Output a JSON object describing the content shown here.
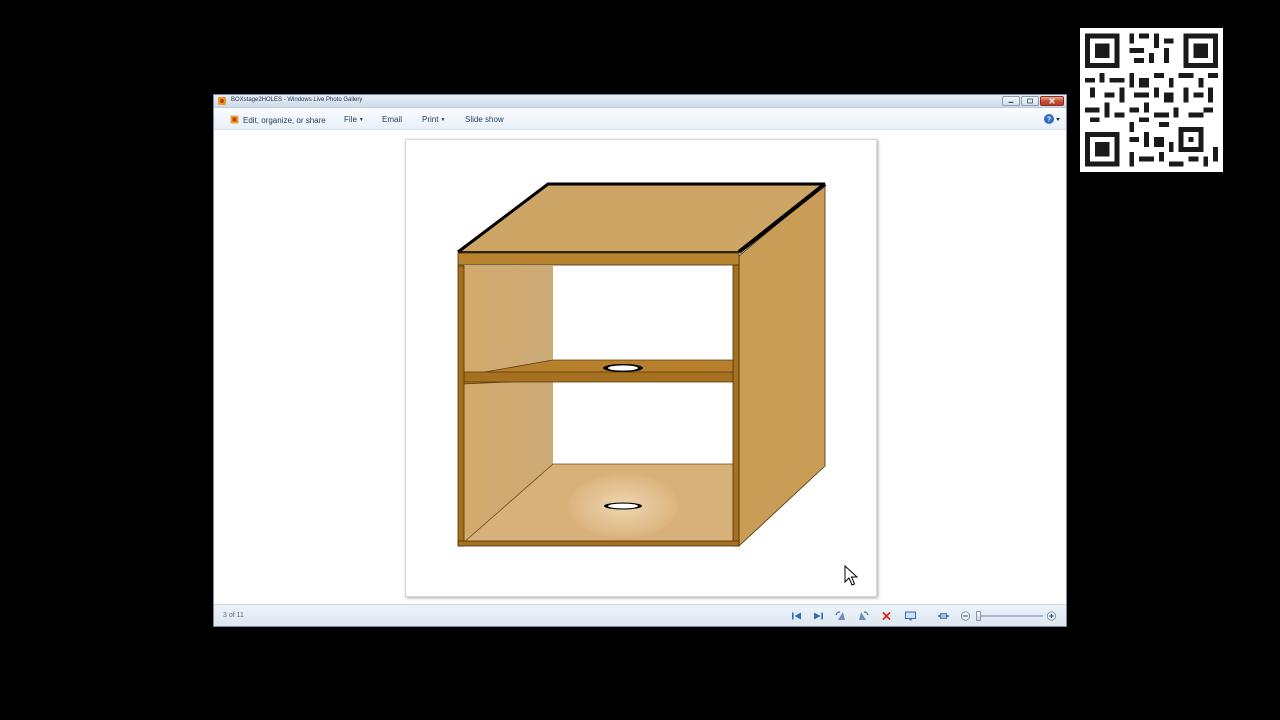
{
  "window": {
    "title": "BOXstage2HOLES - Windows Live Photo Gallery",
    "app_icon": "photo-gallery-icon"
  },
  "menu": {
    "edit_organize": "Edit, organize, or share",
    "file": "File",
    "email": "Email",
    "print": "Print",
    "slideshow": "Slide show",
    "help_icon": "help-icon"
  },
  "viewer": {
    "image_subject": "cabinet-drawing"
  },
  "status": {
    "counter": "3 of 11",
    "buttons": [
      "previous-icon",
      "next-icon",
      "rotate-left-icon",
      "rotate-right-icon",
      "delete-icon",
      "slideshow-icon",
      "fit-to-window-icon",
      "zoom-out-icon",
      "zoom-in-icon"
    ],
    "zoom_level": 0.0
  },
  "colors": {
    "wood_light": "#cda565",
    "wood_mid": "#c99d56",
    "wood_dark": "#a6711f",
    "edge_black": "#000000",
    "titlebar": "#d9e4f1",
    "close_red": "#c64a33",
    "delete_red": "#d42b1e",
    "nav_blue": "#2e6fb5"
  }
}
